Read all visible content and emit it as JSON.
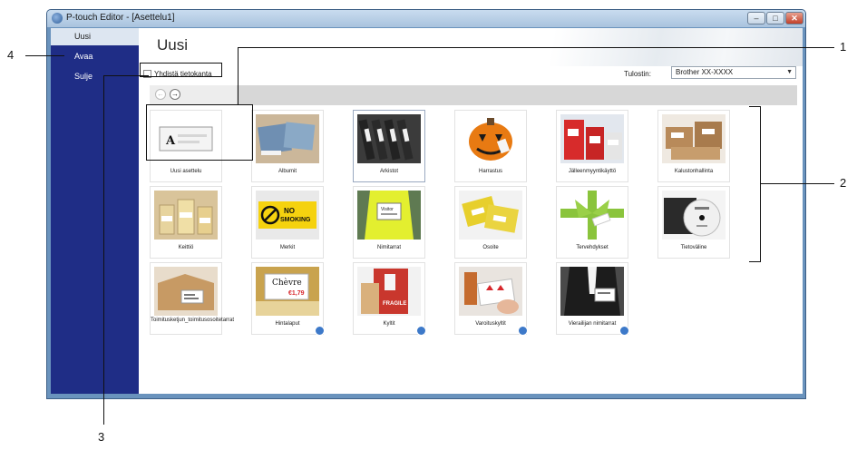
{
  "window": {
    "title": "P-touch Editor - [Asettelu1]"
  },
  "sidebar": {
    "items": [
      {
        "label": "Uusi"
      },
      {
        "label": "Avaa"
      },
      {
        "label": "Sulje"
      }
    ]
  },
  "main": {
    "title": "Uusi",
    "database_checkbox": "Yhdistä tietokanta",
    "printer_label": "Tulostin:",
    "printer_value": "Brother XX-XXXX"
  },
  "templates": [
    {
      "label": "Uusi asettelu"
    },
    {
      "label": "Albumit"
    },
    {
      "label": "Arkistot"
    },
    {
      "label": "Harrastus"
    },
    {
      "label": "Jälleenmyyntikäyttö"
    },
    {
      "label": "Kalustonhallinta"
    },
    {
      "label": "Keittiö"
    },
    {
      "label": "Merkit"
    },
    {
      "label": "Nimitarrat"
    },
    {
      "label": "Osoite"
    },
    {
      "label": "Tervehdykset"
    },
    {
      "label": "Tietoväline"
    },
    {
      "label": "Toimitusketjun_toimitusosoitetarrat"
    },
    {
      "label": "Hintalaput"
    },
    {
      "label": "Kyltit"
    },
    {
      "label": "Varoituskyltit"
    },
    {
      "label": "Vierailijan nimitarrat"
    }
  ],
  "tile_text": {
    "new_layout_letter": "A",
    "no_smoking_1": "NO",
    "no_smoking_2": "SMOKING",
    "chevre": "Chèvre",
    "price": "€1,79",
    "fragile": "FRAGILE",
    "visitor": "Visitor"
  },
  "callouts": {
    "one": "1",
    "two": "2",
    "three": "3",
    "four": "4"
  },
  "colors": {
    "sidebar": "#1f2d86",
    "frame": "#6a93bd",
    "accent": "#3d79c9"
  }
}
